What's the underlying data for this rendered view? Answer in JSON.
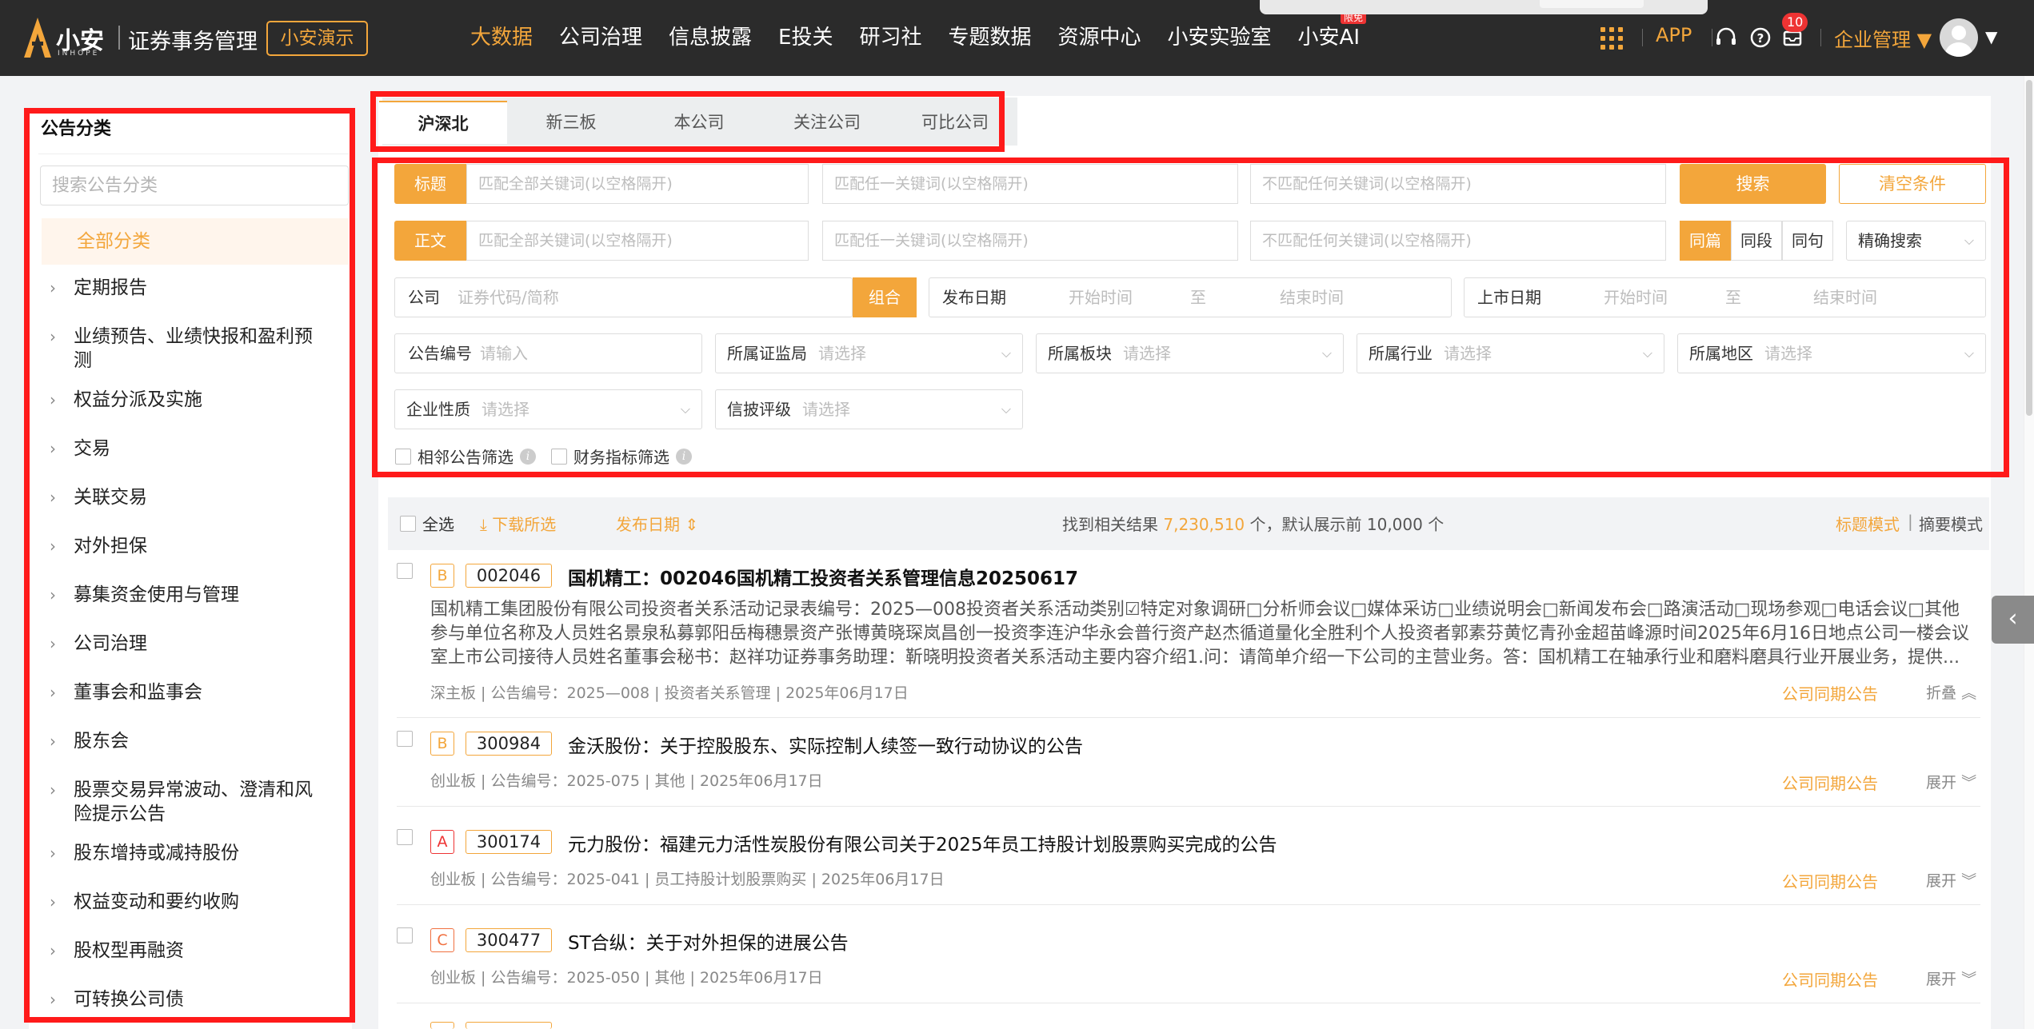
{
  "header": {
    "logo_text": "小安",
    "logo_sub": "INHOPE",
    "app_title": "证券事务管理",
    "demo_button": "小安演示",
    "nav": [
      {
        "label": "大数据",
        "active": true
      },
      {
        "label": "公司治理"
      },
      {
        "label": "信息披露"
      },
      {
        "label": "E投关"
      },
      {
        "label": "研习社"
      },
      {
        "label": "专题数据"
      },
      {
        "label": "资源中心"
      },
      {
        "label": "小安实验室"
      },
      {
        "label": "小安AI",
        "badge": "限免"
      }
    ],
    "app_link": "APP",
    "notification_count": "10",
    "enterprise_menu": "企业管理",
    "icons": [
      "grid-icon",
      "headset-icon",
      "help-icon",
      "inbox-icon",
      "avatar"
    ]
  },
  "sidebar": {
    "title": "公告分类",
    "search_placeholder": "搜索公告分类",
    "all_label": "全部分类",
    "items": [
      {
        "label": "定期报告"
      },
      {
        "label": "业绩预告、业绩快报和盈利预测"
      },
      {
        "label": "权益分派及实施"
      },
      {
        "label": "交易"
      },
      {
        "label": "关联交易"
      },
      {
        "label": "对外担保"
      },
      {
        "label": "募集资金使用与管理"
      },
      {
        "label": "公司治理"
      },
      {
        "label": "董事会和监事会"
      },
      {
        "label": "股东会"
      },
      {
        "label": "股票交易异常波动、澄清和风险提示公告"
      },
      {
        "label": "股东增持或减持股份"
      },
      {
        "label": "权益变动和要约收购"
      },
      {
        "label": "股权型再融资"
      },
      {
        "label": "可转换公司债"
      }
    ]
  },
  "tabs": [
    {
      "label": "沪深北",
      "active": true
    },
    {
      "label": "新三板"
    },
    {
      "label": "本公司"
    },
    {
      "label": "关注公司"
    },
    {
      "label": "可比公司"
    }
  ],
  "filters": {
    "title_chip": "标题",
    "body_chip": "正文",
    "all_kw_placeholder": "匹配全部关键词(以空格隔开)",
    "any_kw_placeholder": "匹配任一关键词(以空格隔开)",
    "none_kw_placeholder": "不匹配任何关键词(以空格隔开)",
    "search_button": "搜索",
    "clear_button": "清空条件",
    "scope": [
      {
        "label": "同篇",
        "active": true
      },
      {
        "label": "同段"
      },
      {
        "label": "同句"
      }
    ],
    "mode_select": "精确搜索",
    "company_label": "公司",
    "company_placeholder": "证券代码/简称",
    "company_group_button": "组合",
    "publish_date_label": "发布日期",
    "listing_date_label": "上市日期",
    "start_placeholder": "开始时间",
    "to_label": "至",
    "end_placeholder": "结束时间",
    "notice_no_label": "公告编号",
    "notice_no_placeholder": "请输入",
    "select_placeholder": "请选择",
    "selects_row1": [
      "所属证监局",
      "所属板块",
      "所属行业",
      "所属地区"
    ],
    "selects_row2": [
      "企业性质",
      "信披评级"
    ],
    "adjacent_filter": "相邻公告筛选",
    "finance_filter": "财务指标筛选"
  },
  "results_bar": {
    "select_all": "全选",
    "download": "下载所选",
    "sort": "发布日期",
    "found_prefix": "找到相关结果",
    "found_count": "7,230,510",
    "found_suffix": "个，默认展示前 10,000 个",
    "title_mode": "标题模式",
    "separator": "|",
    "summary_mode": "摘要模式"
  },
  "results": [
    {
      "grade": "B",
      "code": "002046",
      "title": "国机精工：002046国机精工投资者关系管理信息20250617",
      "summary": "国机精工集团股份有限公司投资者关系活动记录表编号：2025—008投资者关系活动类别☑特定对象调研□分析师会议□媒体采访□业绩说明会□新闻发布会□路演活动□现场参观□电话会议□其他参与单位名称及人员姓名景泉私募郭阳岳梅穗景资产张博黄晓琛岚昌创一投资李连沪华永会普行资产赵杰循道量化全胜利个人投资者郭素芬黄忆青孙金超苗峰源时间2025年6月16日地点公司一楼会议室上市公司接待人员姓名董事会秘书：赵祥功证券事务助理：靳晓明投资者关系活动主要内容介绍1.问：请简单介绍一下公司的主营业务。答：国机精工在轴承行业和磨料磨具行业开展业务，提供...",
      "meta": "深主板 | 公告编号：2025—008 | 投资者关系管理 | 2025年06月17日",
      "same_period": "公司同期公告",
      "fold": "折叠"
    },
    {
      "grade": "B",
      "code": "300984",
      "title": "金沃股份：关于控股股东、实际控制人续签一致行动协议的公告",
      "meta": "创业板 | 公告编号：2025-075 | 其他 | 2025年06月17日",
      "same_period": "公司同期公告",
      "fold": "展开"
    },
    {
      "grade": "A",
      "code": "300174",
      "title": "元力股份：福建元力活性炭股份有限公司关于2025年员工持股计划股票购买完成的公告",
      "meta": "创业板 | 公告编号：2025-041 | 员工持股计划股票购买 | 2025年06月17日",
      "same_period": "公司同期公告",
      "fold": "展开"
    },
    {
      "grade": "C",
      "code": "300477",
      "title": "ST合纵：关于对外担保的进展公告",
      "meta": "创业板 | 公告编号：2025-050 | 其他 | 2025年06月17日",
      "same_period": "公司同期公告",
      "fold": "展开"
    }
  ]
}
